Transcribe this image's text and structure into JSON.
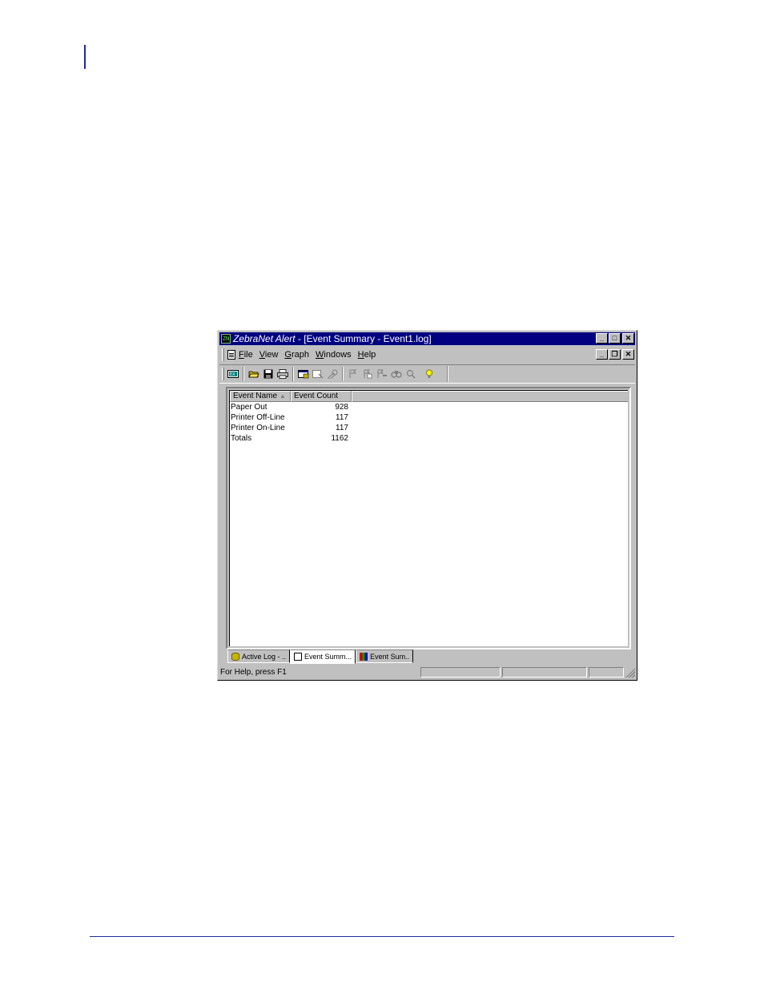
{
  "window": {
    "app_name": "ZebraNet Alert",
    "title_rest": " - [Event Summary - Event1.log]",
    "app_icon_text": "ZN"
  },
  "menu": [
    {
      "key": "F",
      "rest": "ile"
    },
    {
      "key": "V",
      "rest": "iew"
    },
    {
      "key": "G",
      "rest": "raph"
    },
    {
      "key": "W",
      "rest": "indows"
    },
    {
      "key": "H",
      "rest": "elp"
    }
  ],
  "toolbar_icons": [
    "export-icon",
    "open-folder-icon",
    "save-icon",
    "print-icon",
    "add-log-icon",
    "view-log-icon",
    "properties-icon",
    "filter-icon",
    "filter-copy-icon",
    "filter-alt-icon",
    "find-icon",
    "zoom-icon",
    "help-bulb-icon"
  ],
  "list": {
    "columns": [
      "Event Name",
      "Event Count"
    ],
    "sort_indicator": "▲",
    "rows": [
      {
        "name": "Paper Out",
        "count": "928"
      },
      {
        "name": "Printer Off-Line",
        "count": "117"
      },
      {
        "name": "Printer On-Line",
        "count": "117"
      },
      {
        "name": "Totals",
        "count": "1162"
      }
    ]
  },
  "tabs": [
    {
      "label": "Active Log - ..",
      "icon": "database-icon"
    },
    {
      "label": "Event Summ...",
      "icon": "document-icon"
    },
    {
      "label": "Event Sum..",
      "icon": "chart-icon"
    }
  ],
  "status": {
    "text": "For Help, press F1"
  }
}
